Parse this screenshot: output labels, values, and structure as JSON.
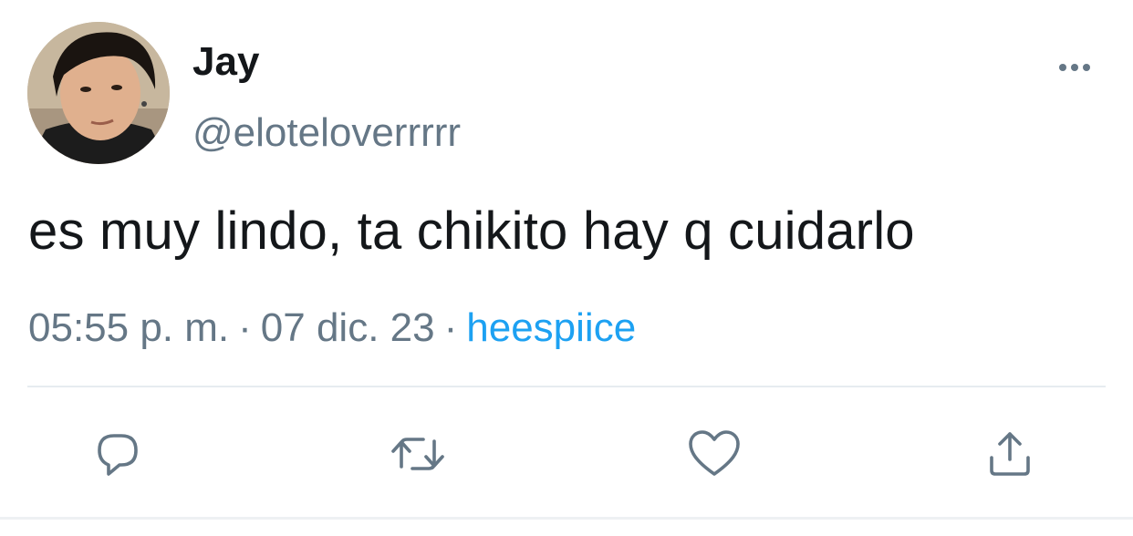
{
  "tweet": {
    "display_name": "Jay",
    "handle": "@eloteloverrrrr",
    "text": "es muy lindo, ta chikito hay q cuidarlo",
    "time": "05:55 p. m.",
    "separator": "·",
    "date": "07 dic. 23",
    "source": "heespiice"
  },
  "icons": {
    "more": "more-horizontal-icon",
    "reply": "reply-bubble-icon",
    "retweet": "retweet-icon",
    "like": "heart-icon",
    "share": "share-upload-icon"
  },
  "colors": {
    "text": "#14171a",
    "secondary": "#657786",
    "link": "#1da1f2",
    "divider": "#e6ecf0"
  }
}
